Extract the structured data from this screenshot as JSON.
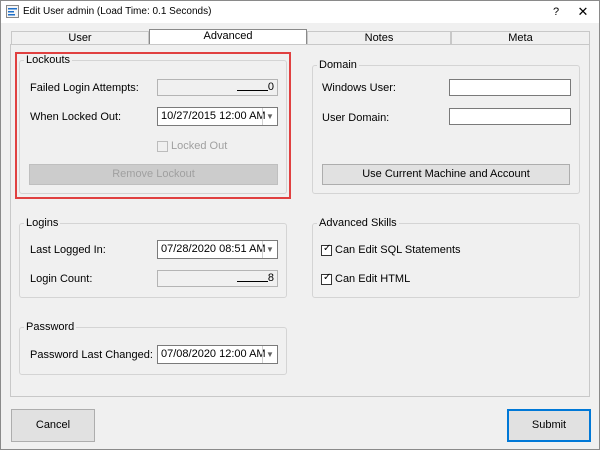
{
  "window": {
    "title": "Edit User admin (Load Time: 0.1 Seconds)",
    "help": "?",
    "close": "✕"
  },
  "tabs": [
    {
      "label": "User"
    },
    {
      "label": "Advanced"
    },
    {
      "label": "Notes"
    },
    {
      "label": "Meta"
    }
  ],
  "lockouts": {
    "group": "Lockouts",
    "failed_label": "Failed Login Attempts:",
    "failed_value": "0",
    "locked_label": "When Locked Out:",
    "locked_value": "10/27/2015 12:00 AM",
    "locked_out_label": "Locked Out",
    "locked_out_checked": false,
    "remove_button": "Remove Lockout"
  },
  "domain": {
    "group": "Domain",
    "windows_user_label": "Windows User:",
    "windows_user_value": "",
    "user_domain_label": "User Domain:",
    "user_domain_value": "",
    "use_current_button": "Use Current Machine and Account"
  },
  "logins": {
    "group": "Logins",
    "last_logged_label": "Last Logged In:",
    "last_logged_value": "07/28/2020 08:51 AM",
    "count_label": "Login Count:",
    "count_value": "8"
  },
  "skills": {
    "group": "Advanced Skills",
    "sql_label": "Can Edit SQL Statements",
    "sql_checked": true,
    "html_label": "Can Edit HTML",
    "html_checked": true
  },
  "password": {
    "group": "Password",
    "changed_label": "Password Last Changed:",
    "changed_value": "07/08/2020 12:00 AM"
  },
  "footer": {
    "cancel": "Cancel",
    "submit": "Submit"
  },
  "colors": {
    "highlight": "#e04040",
    "default_button": "#0078d7"
  }
}
